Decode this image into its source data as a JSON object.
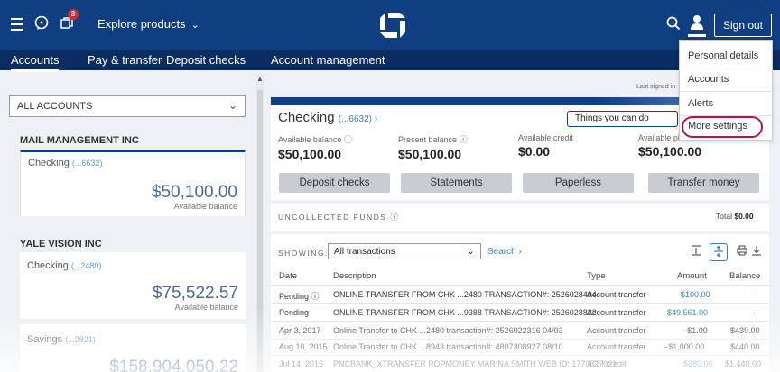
{
  "header": {
    "notification_count": "3",
    "explore_label": "Explore products",
    "signout_label": "Sign out"
  },
  "nav": {
    "tabs": [
      "Accounts",
      "Pay & transfer",
      "Deposit checks",
      "Account management"
    ]
  },
  "profile_menu": {
    "items": [
      "Personal details",
      "Accounts",
      "Alerts",
      "More settings"
    ]
  },
  "sidebar": {
    "filter_value": "ALL ACCOUNTS",
    "groups": [
      {
        "company": "MAIL MANAGEMENT INC",
        "accounts": [
          {
            "name": "Checking",
            "mask": "(...6632)",
            "balance": "$50,100.00",
            "balance_label": "Available balance"
          }
        ]
      },
      {
        "company": "YALE VISION INC",
        "accounts": [
          {
            "name": "Checking",
            "mask": "(...2480)",
            "balance": "$75,522.57",
            "balance_label": "Available balance"
          },
          {
            "name": "Savings",
            "mask": "(...2821)",
            "balance": "$158,904,050.22",
            "balance_label": ""
          }
        ]
      }
    ]
  },
  "account": {
    "last_signed": "Last signed in",
    "title": "Checking",
    "mask": "(...6632)",
    "things_label": "Things you can do",
    "balances": [
      {
        "label": "Available balance",
        "value": "$50,100.00"
      },
      {
        "label": "Present balance",
        "value": "$50,100.00"
      },
      {
        "label": "Available credit",
        "value": "$0.00"
      },
      {
        "label": "Available plus credit",
        "value": "$50,100.00"
      }
    ],
    "actions": [
      "Deposit checks",
      "Statements",
      "Paperless",
      "Transfer money"
    ],
    "uncollected_label": "UNCOLLECTED FUNDS",
    "total_label": "Total",
    "total_value": "$0.00"
  },
  "transactions": {
    "showing_label": "SHOWING:",
    "filter_value": "All transactions",
    "search_label": "Search",
    "headers": [
      "Date",
      "Description",
      "Type",
      "Amount",
      "Balance"
    ],
    "rows": [
      {
        "date": "Pending",
        "desc": "ONLINE TRANSFER FROM CHK ...2480 TRANSACTION#: 2526028494",
        "type": "Account transfer",
        "amount": "$100.00",
        "balance": "--"
      },
      {
        "date": "Pending",
        "desc": "ONLINE TRANSFER FROM CHK ...9388 TRANSACTION#: 2526028822",
        "type": "Account transfer",
        "amount": "$49,561.00",
        "balance": "--"
      },
      {
        "date": "Apr 3, 2017",
        "desc": "Online Transfer to CHK ...2480 transaction#: 2526022316 04/03",
        "type": "Account transfer",
        "amount": "−$1.00",
        "balance": "$439.00"
      },
      {
        "date": "Aug 10, 2015",
        "desc": "Online Transfer to CHK ...8943 transaction#: 4807308927 08/10",
        "type": "Account transfer",
        "amount": "−$1,000.00",
        "balance": "$440.00"
      },
      {
        "date": "Jul 14, 2015",
        "desc": "PNCBANK_XTRANSFER POPMONEY MARINA SMITH WEB ID: 1770527921",
        "type": "ACH credit",
        "amount": "$880.00",
        "balance": "$1,440.00"
      }
    ]
  },
  "colors": {
    "brand": "#0f3f80",
    "nav": "#0c2d61",
    "link": "#3a7ec0",
    "highlight": "#b5154a"
  }
}
